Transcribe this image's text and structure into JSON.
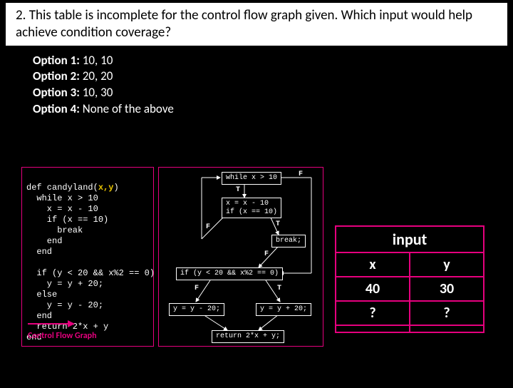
{
  "question": {
    "number": "2.",
    "text": "This table is incomplete for the control flow graph given. Which input would help achieve condition coverage?"
  },
  "options": [
    {
      "label": "Option 1:",
      "value": "10, 10"
    },
    {
      "label": "Option 2:",
      "value": "20, 20"
    },
    {
      "label": "Option 3:",
      "value": "10, 30"
    },
    {
      "label": "Option 4:",
      "value": "None of the above"
    }
  ],
  "code": {
    "def_prefix": "def candyland(",
    "def_args": "x,y",
    "def_suffix": ")",
    "lines": [
      "  while x > 10",
      "    x = x - 10",
      "    if (x == 10)",
      "      break",
      "    end",
      "  end",
      "",
      "  if (y < 20 && x%2 == 0)",
      "    y = y + 20;",
      "  else",
      "    y = y - 20;",
      "  end",
      "  return 2*x + y",
      "end"
    ],
    "cfg_label": "Control Flow Graph"
  },
  "flow": {
    "n_while": "while x > 10",
    "n_assign": "x = x - 10\nif (x == 10)",
    "n_break": "break;",
    "n_cond": "if (y < 20 && x%2 == 0)",
    "n_minus": "y = y - 20;",
    "n_plus": "y = y + 20;",
    "n_return": "return 2*x + y;",
    "t": "T",
    "f": "F"
  },
  "table": {
    "header": "input",
    "col_x": "x",
    "col_y": "y",
    "rows": [
      {
        "x": "40",
        "y": "30"
      },
      {
        "x": "?",
        "y": "?"
      },
      {
        "x": "",
        "y": ""
      }
    ]
  }
}
